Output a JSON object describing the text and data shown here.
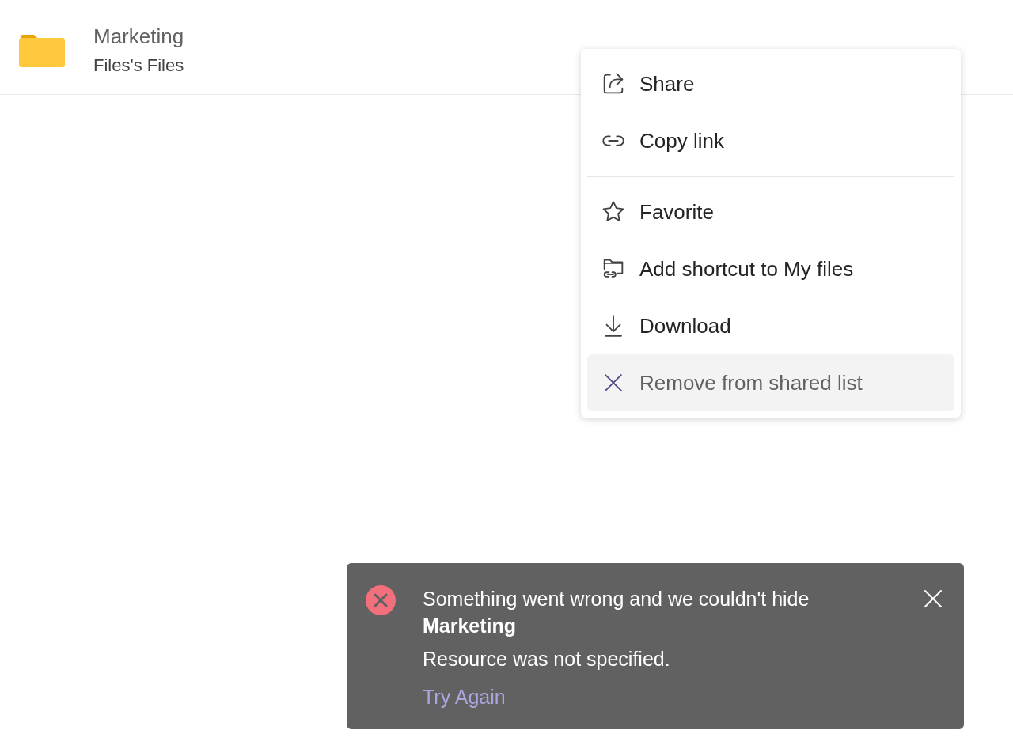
{
  "file_row": {
    "name": "Marketing",
    "owner": "Files's Files"
  },
  "menu": {
    "groups": [
      [
        {
          "kind": "share",
          "label": "Share",
          "highlighted": false
        },
        {
          "kind": "link",
          "label": "Copy link",
          "highlighted": false
        }
      ],
      [
        {
          "kind": "star",
          "label": "Favorite",
          "highlighted": false
        },
        {
          "kind": "shortcut",
          "label": "Add shortcut to My files",
          "highlighted": false
        },
        {
          "kind": "download",
          "label": "Download",
          "highlighted": false
        },
        {
          "kind": "remove",
          "label": "Remove from shared list",
          "highlighted": true
        }
      ]
    ]
  },
  "toast": {
    "message": "Something went wrong and we couldn't hide",
    "item": "Marketing",
    "detail": "Resource was not specified.",
    "action": "Try Again"
  }
}
